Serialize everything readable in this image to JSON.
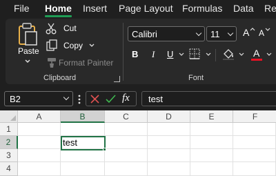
{
  "menu": {
    "tabs": [
      {
        "label": "File"
      },
      {
        "label": "Home"
      },
      {
        "label": "Insert"
      },
      {
        "label": "Page Layout"
      },
      {
        "label": "Formulas"
      },
      {
        "label": "Data"
      },
      {
        "label": "Re"
      }
    ],
    "active_tab": "Home"
  },
  "ribbon": {
    "clipboard": {
      "paste_label": "Paste",
      "cut_label": "Cut",
      "copy_label": "Copy",
      "format_painter_label": "Format Painter",
      "group_label": "Clipboard"
    },
    "font": {
      "font_name": "Calibri",
      "font_size": "11",
      "bold_label": "B",
      "italic_label": "I",
      "underline_label": "U",
      "grow_label": "A",
      "shrink_label": "A",
      "font_color_label": "A",
      "group_label": "Font"
    }
  },
  "formula_bar": {
    "name_box": "B2",
    "fx_label": "fx",
    "formula": "test"
  },
  "sheet": {
    "columns": [
      "A",
      "B",
      "C",
      "D",
      "E",
      "F"
    ],
    "rows": [
      "1",
      "2",
      "3",
      "4"
    ],
    "selected_column": "B",
    "selected_row": "2",
    "cell_values": {
      "B2": "test"
    }
  },
  "colors": {
    "accent_green": "#217346",
    "tab_underline": "#1f9d55",
    "ribbon_bg": "#292929",
    "app_bg": "#1f1f1f",
    "font_color_bar": "#e81123",
    "cancel_red": "#e05252",
    "enter_green": "#3fb950"
  }
}
